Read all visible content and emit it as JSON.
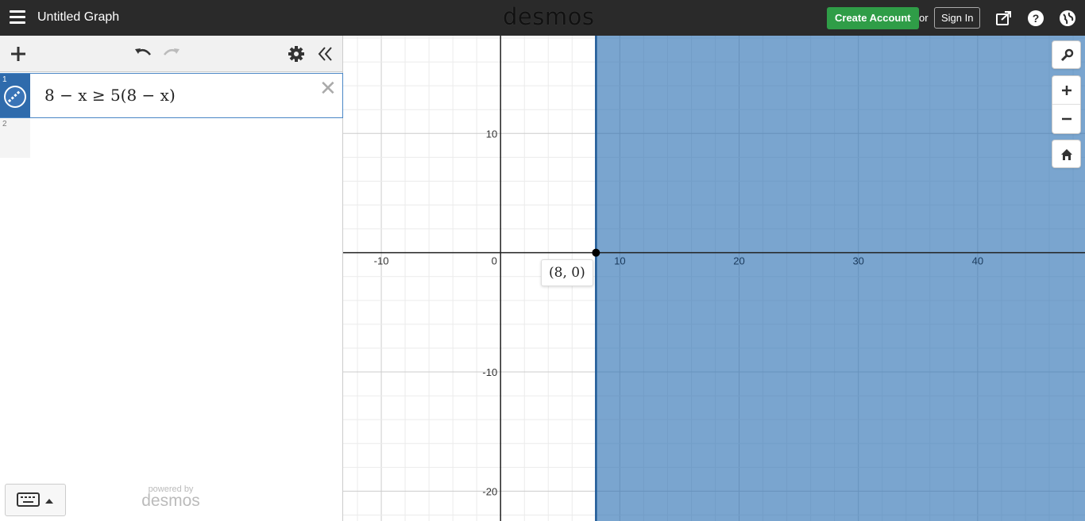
{
  "header": {
    "title": "Untitled Graph",
    "brand": "desmos",
    "create_account": "Create Account",
    "or": "or",
    "sign_in": "Sign In"
  },
  "expressions": [
    {
      "number": "1",
      "latex_text": "8 − x  ≥ 5(8 − x)",
      "color": "#2d70b3"
    },
    {
      "number": "2",
      "latex_text": ""
    }
  ],
  "footer": {
    "powered_by": "powered by",
    "brand": "desmos"
  },
  "graph": {
    "x_ticks": [
      "-10",
      "0",
      "10",
      "20",
      "30",
      "40"
    ],
    "y_ticks": [
      "10",
      "-10",
      "-20"
    ],
    "point_label": "(8, 0)",
    "shaded_region": "x ≥ 8",
    "shade_color": "#2d70b3",
    "x_range": [
      -13.2,
      49.0
    ],
    "y_range": [
      -22.5,
      18.2
    ]
  }
}
